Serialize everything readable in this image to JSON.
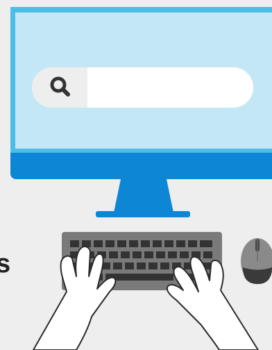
{
  "search": {
    "placeholder": "",
    "value": ""
  },
  "side_text": "s",
  "colors": {
    "background": "#eeeeee",
    "monitor_frame": "#4bbde6",
    "monitor_screen": "#c4e7f6",
    "monitor_bezel": "#0d86d6",
    "keyboard_body": "#7a7a7a",
    "keyboard_keys": "#333333",
    "mouse_body": "#8a8a8a",
    "hands": "#ffffff"
  },
  "icons": {
    "search": "search-icon"
  }
}
